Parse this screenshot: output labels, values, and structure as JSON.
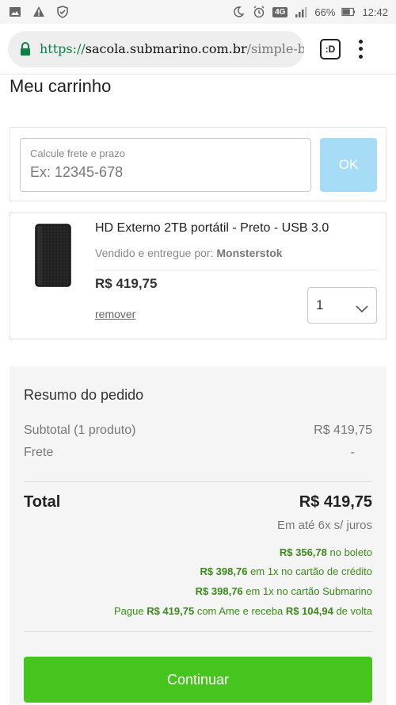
{
  "status_bar": {
    "icons_left": [
      "image-icon",
      "warning-icon",
      "shield-icon"
    ],
    "icons_right": [
      "moon-icon",
      "alarm-icon",
      "signal-icon",
      "battery-icon"
    ],
    "network": "4G",
    "battery": "66%",
    "time": "12:42"
  },
  "browser": {
    "url_scheme": "https://",
    "url_host": "sacola.submarino.com.br",
    "url_path": "/simple-bas",
    "tabs_label": ":D"
  },
  "page": {
    "title": "Meu carrinho"
  },
  "freight": {
    "label": "Calcule frete e prazo",
    "placeholder": "Ex: 12345-678",
    "ok_label": "OK"
  },
  "product": {
    "name": "HD Externo 2TB portátil - Preto - USB 3.0",
    "seller_prefix": "Vendido e entregue por:",
    "seller": "Monsterstok",
    "price": "R$ 419,75",
    "remove_label": "remover",
    "quantity": "1"
  },
  "summary": {
    "title": "Resumo do pedido",
    "subtotal_label": "Subtotal (1 produto)",
    "subtotal_value": "R$ 419,75",
    "freight_label": "Frete",
    "freight_value": "-",
    "total_label": "Total",
    "total_value": "R$ 419,75",
    "installments": "Em até 6x s/ juros",
    "payments": [
      {
        "pre": "",
        "amount": "R$ 356,78",
        "post": "no boleto"
      },
      {
        "pre": "",
        "amount": "R$ 398,76",
        "post": "em 1x no cartão de crédito"
      },
      {
        "pre": "",
        "amount": "R$ 398,76",
        "post": "em 1x no cartão Submarino"
      }
    ],
    "ame": {
      "pre": "Pague",
      "amount": "R$ 419,75",
      "mid": "com Ame e receba",
      "cashback": "R$ 104,94",
      "post": "de volta"
    },
    "continue_label": "Continuar"
  },
  "colors": {
    "accent_green": "#47c51f",
    "price_green": "#3a8a1a",
    "ok_blue": "#a6dcf6"
  }
}
